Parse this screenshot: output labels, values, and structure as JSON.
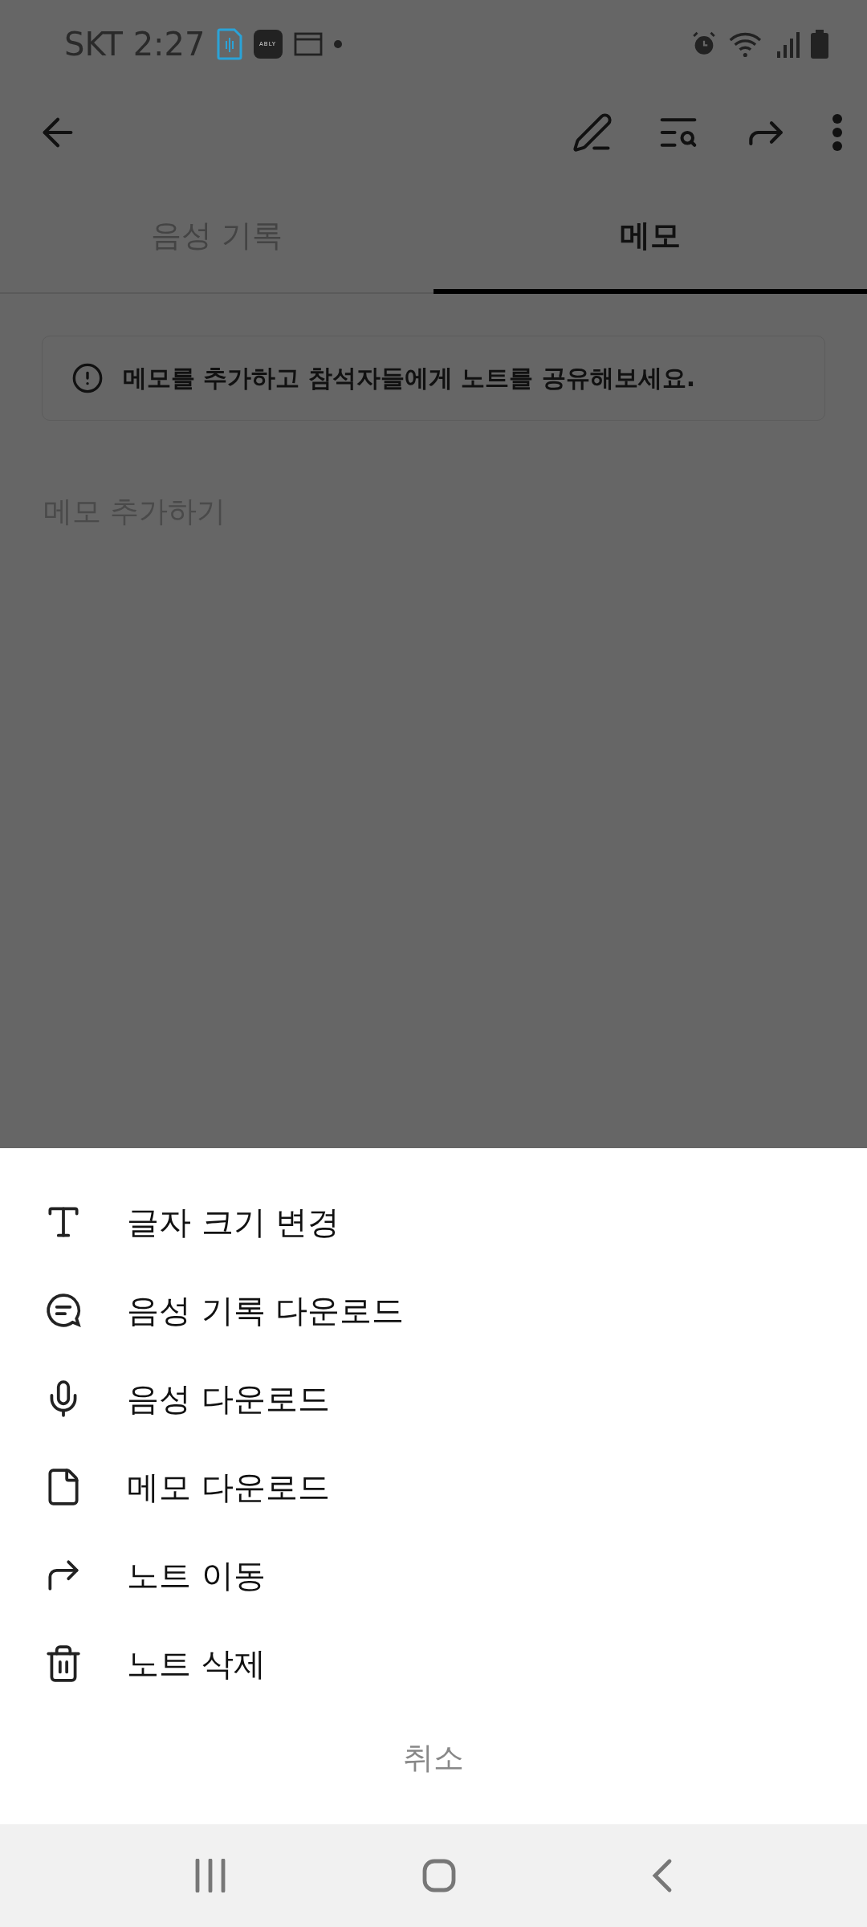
{
  "status_bar": {
    "carrier_time": "SKT 2:27",
    "app_badge": "ABLY"
  },
  "tabs": [
    {
      "label": "음성 기록",
      "selected": false
    },
    {
      "label": "메모",
      "selected": true
    }
  ],
  "notice": {
    "text": "메모를 추가하고 참석자들에게 노트를 공유해보세요."
  },
  "memo": {
    "placeholder": "메모 추가하기"
  },
  "sheet": {
    "items": [
      {
        "label": "글자 크기 변경",
        "kind": "text"
      },
      {
        "label": "음성 기록 다운로드",
        "kind": "chat"
      },
      {
        "label": "음성 다운로드",
        "kind": "mic"
      },
      {
        "label": "메모 다운로드",
        "kind": "file"
      },
      {
        "label": "노트 이동",
        "kind": "move"
      },
      {
        "label": "노트 삭제",
        "kind": "trash"
      }
    ],
    "cancel": "취소"
  }
}
